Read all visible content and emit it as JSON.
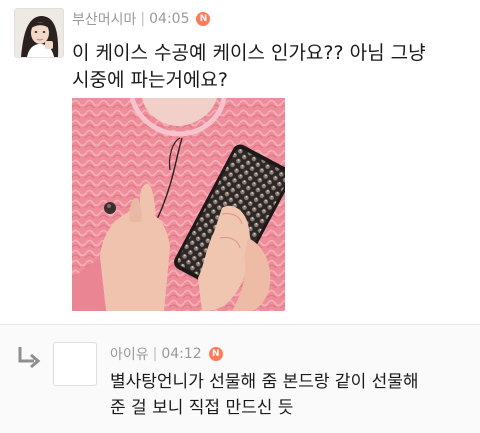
{
  "post": {
    "author": "부산머시마",
    "time": "04:05",
    "badge": "N",
    "text_line1": "이 케이스 수공예 케이스 인가요?? 아님 그냥",
    "text_line2": "시중에 파는거에요?"
  },
  "comment": {
    "author": "아이유",
    "time": "04:12",
    "badge": "N",
    "text_line1": "별사탕언니가 선물해 줌 본드랑 같이 선물해",
    "text_line2": "준 걸 보니 직접 만드신 듯"
  },
  "colors": {
    "badge": "#ff7a59",
    "meta_text": "#9a9a9a",
    "sweater_pink": "#ef8f9c",
    "phone_case": "#3a3232"
  },
  "icons": {
    "reply": "reply-arrow-icon",
    "new_badge": "new-badge-icon"
  }
}
